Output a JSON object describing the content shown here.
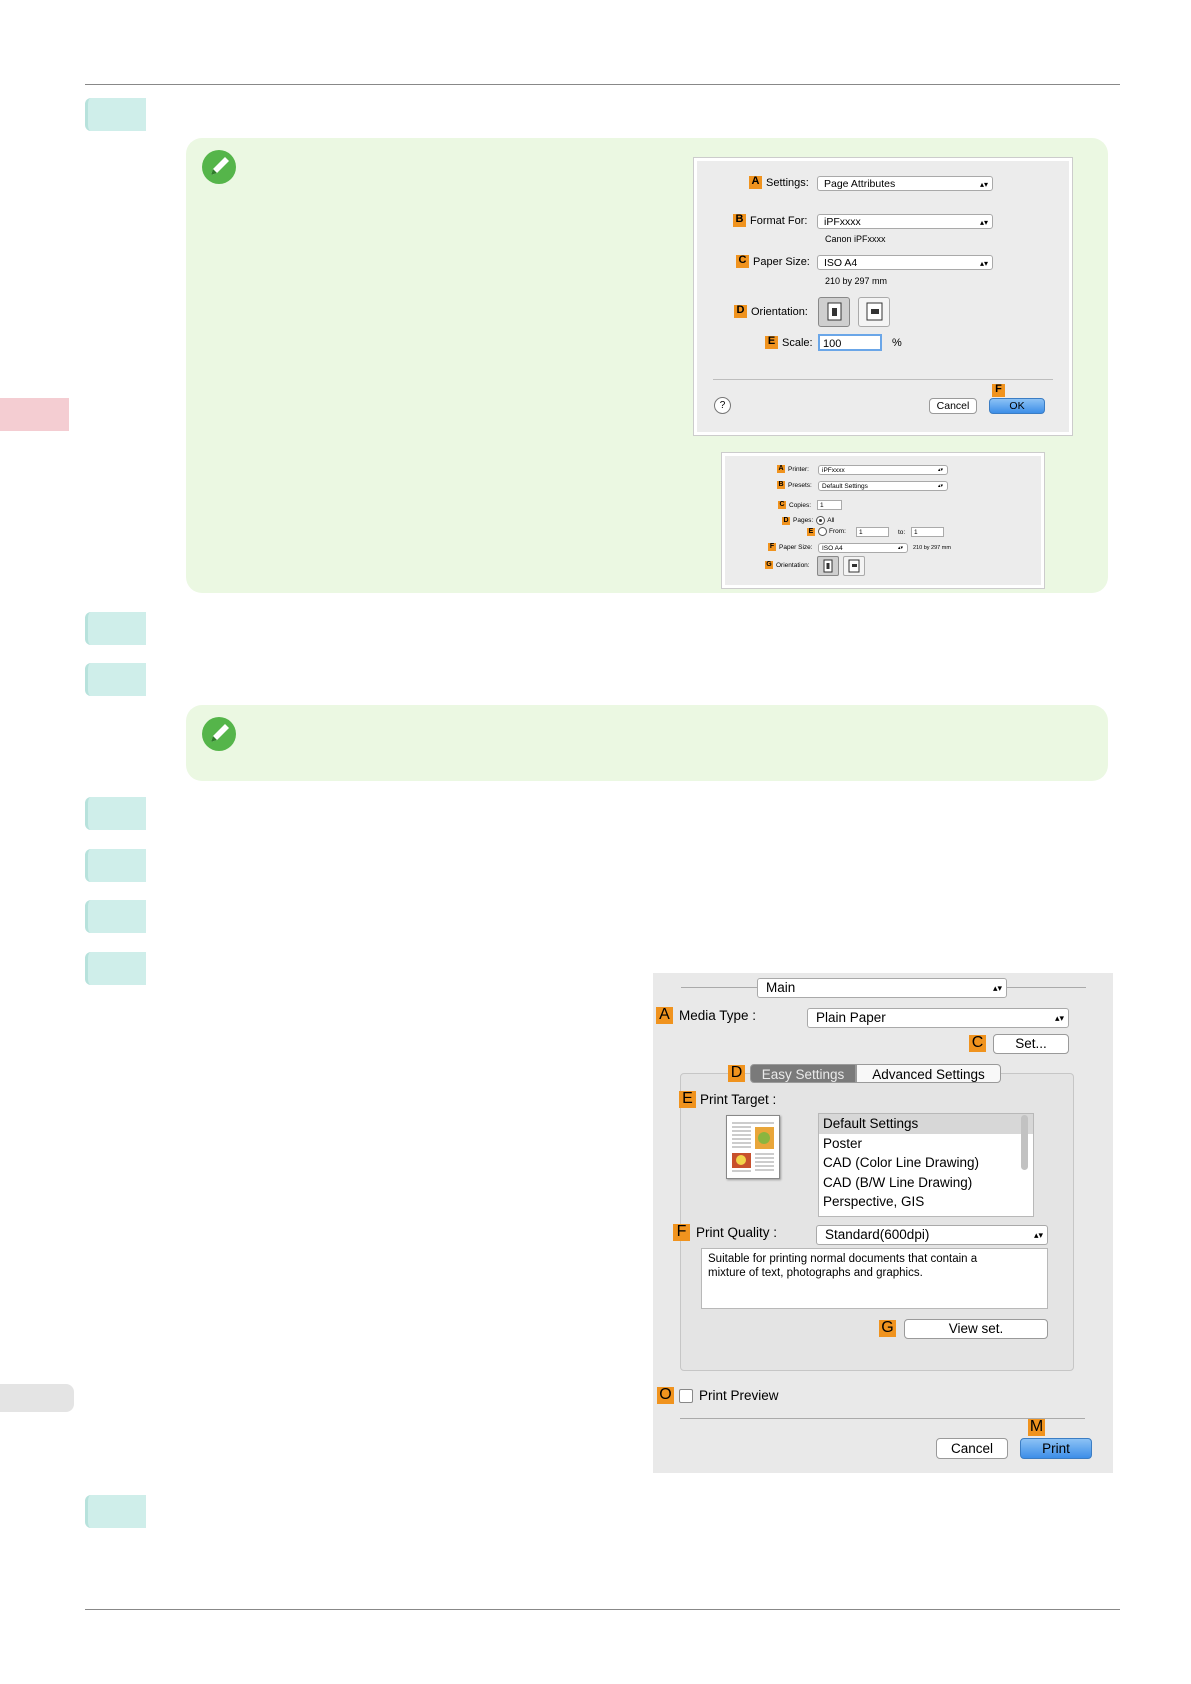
{
  "dialog_page_setup": {
    "settings_label": "Settings:",
    "settings_value": "Page Attributes",
    "format_label": "Format For:",
    "format_value": "iPFxxxx",
    "format_sub": "Canon iPFxxxx",
    "paper_label": "Paper Size:",
    "paper_value": "ISO A4",
    "paper_sub": "210 by 297 mm",
    "orientation_label": "Orientation:",
    "scale_label": "Scale:",
    "scale_value": "100",
    "scale_unit": "%",
    "help": "?",
    "cancel": "Cancel",
    "ok": "OK",
    "labels": {
      "a": "A",
      "b": "B",
      "c": "C",
      "d": "D",
      "e": "E",
      "f": "F"
    }
  },
  "dialog_print_small": {
    "printer_label": "Printer:",
    "printer_value": "iPFxxxx",
    "presets_label": "Presets:",
    "presets_value": "Default Settings",
    "copies_label": "Copies:",
    "copies_value": "1",
    "pages_label": "Pages:",
    "pages_all": "All",
    "from_label": "From:",
    "from_value": "1",
    "to_label": "to:",
    "to_value": "1",
    "paper_label": "Paper Size:",
    "paper_value": "ISO A4",
    "paper_sub": "210 by 297 mm",
    "orientation_label": "Orientation:",
    "labels": {
      "a": "A",
      "b": "B",
      "c": "C",
      "d": "D",
      "e": "E",
      "f": "F",
      "g": "G"
    }
  },
  "dialog_print_main": {
    "panel_select": "Main",
    "media_label": "Media Type :",
    "media_value": "Plain Paper",
    "set_button": "Set...",
    "tab_easy": "Easy Settings",
    "tab_advanced": "Advanced Settings",
    "print_target_label": "Print Target :",
    "targets": [
      "Default Settings",
      "Poster",
      "CAD (Color Line Drawing)",
      "CAD (B/W Line Drawing)",
      "Perspective, GIS"
    ],
    "quality_label": "Print Quality :",
    "quality_value": "Standard(600dpi)",
    "description": "Suitable for printing normal documents that contain a mixture of text, photographs and graphics.",
    "view_set_button": "View set.",
    "preview_label": "Print Preview",
    "cancel": "Cancel",
    "print": "Print",
    "labels": {
      "a": "A",
      "c": "C",
      "d": "D",
      "e": "E",
      "f": "F",
      "g": "G",
      "o": "O",
      "m": "M"
    }
  }
}
